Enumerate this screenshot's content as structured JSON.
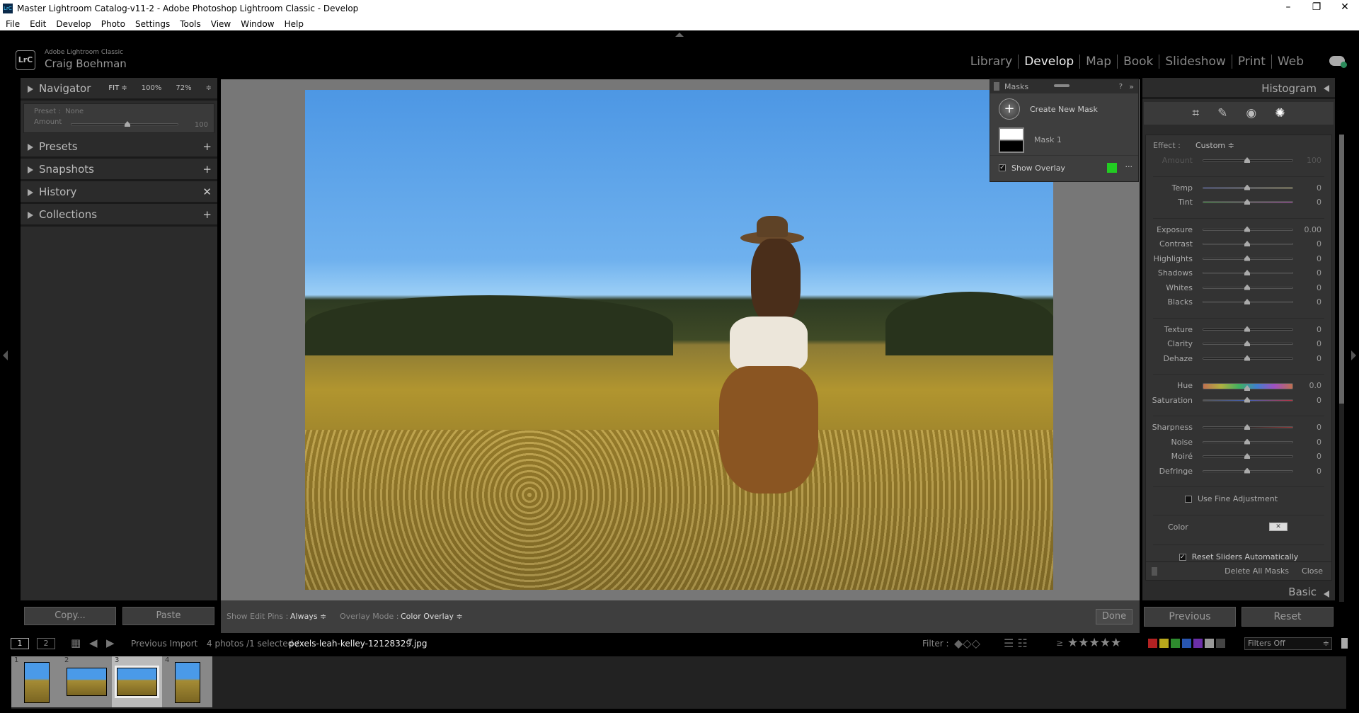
{
  "window": {
    "title": "Master Lightroom Catalog-v11-2 - Adobe Photoshop Lightroom Classic - Develop",
    "logo": "LrC",
    "min": "–",
    "max": "❐",
    "close": "✕"
  },
  "menu": [
    "File",
    "Edit",
    "Develop",
    "Photo",
    "Settings",
    "Tools",
    "View",
    "Window",
    "Help"
  ],
  "identity": {
    "product": "Adobe Lightroom Classic",
    "user": "Craig Boehman",
    "logo": "LrC"
  },
  "modules": [
    {
      "label": "Library",
      "active": false
    },
    {
      "label": "Develop",
      "active": true
    },
    {
      "label": "Map",
      "active": false
    },
    {
      "label": "Book",
      "active": false
    },
    {
      "label": "Slideshow",
      "active": false
    },
    {
      "label": "Print",
      "active": false
    },
    {
      "label": "Web",
      "active": false
    }
  ],
  "left": {
    "navigator": {
      "label": "Navigator",
      "fit": "FIT ≑",
      "z1": "100%",
      "z2": "72%",
      "stepper": "≑"
    },
    "preset": {
      "preset_label": "Preset :",
      "preset_value": "None",
      "amount_label": "Amount",
      "amount_value": "100",
      "amount_fraction": 0.5
    },
    "panels": [
      {
        "label": "Presets",
        "icon": "+"
      },
      {
        "label": "Snapshots",
        "icon": "+"
      },
      {
        "label": "History",
        "icon": "✕"
      },
      {
        "label": "Collections",
        "icon": "+"
      }
    ],
    "copy": "Copy...",
    "paste": "Paste"
  },
  "toolbar": {
    "pins_label": "Show Edit Pins :",
    "pins_value": "Always ≑",
    "overlay_label": "Overlay Mode :",
    "overlay_value": "Color Overlay ≑",
    "done": "Done"
  },
  "masks": {
    "title": "Masks",
    "help": "?",
    "collapse": "»",
    "create": "Create New Mask",
    "mask1": "Mask 1",
    "show_overlay": "Show Overlay",
    "overlay_checked": true,
    "overlay_color": "#22cc22",
    "more": "···"
  },
  "right": {
    "histogram": "Histogram",
    "effect_label": "Effect :",
    "effect_value": "Custom ≑",
    "groups": [
      [
        {
          "label": "Amount",
          "value": "100",
          "dim": true
        }
      ],
      [
        {
          "label": "Temp",
          "value": "0",
          "track": "temp"
        },
        {
          "label": "Tint",
          "value": "0",
          "track": "tint"
        }
      ],
      [
        {
          "label": "Exposure",
          "value": "0.00"
        },
        {
          "label": "Contrast",
          "value": "0"
        },
        {
          "label": "Highlights",
          "value": "0"
        },
        {
          "label": "Shadows",
          "value": "0"
        },
        {
          "label": "Whites",
          "value": "0"
        },
        {
          "label": "Blacks",
          "value": "0"
        }
      ],
      [
        {
          "label": "Texture",
          "value": "0"
        },
        {
          "label": "Clarity",
          "value": "0"
        },
        {
          "label": "Dehaze",
          "value": "0"
        }
      ],
      [
        {
          "label": "Hue",
          "value": "0.0",
          "track": "hue"
        }
      ],
      [
        {
          "label": "Saturation",
          "value": "0",
          "track": "sat"
        }
      ],
      [
        {
          "label": "Sharpness",
          "value": "0",
          "track": "sharp"
        },
        {
          "label": "Noise",
          "value": "0"
        },
        {
          "label": "Moiré",
          "value": "0"
        },
        {
          "label": "Defringe",
          "value": "0"
        }
      ]
    ],
    "fine_adjust": "Use Fine Adjustment",
    "color_label": "Color",
    "reset_auto": "Reset Sliders Automatically",
    "delete_all": "Delete All Masks",
    "close": "Close",
    "basic": "Basic",
    "previous": "Previous",
    "reset": "Reset"
  },
  "filmstrip": {
    "view1": "1",
    "view2": "2",
    "source": "Previous Import",
    "count": "4 photos /1 selected /",
    "filename": "pexels-leah-kelley-12128329.jpg",
    "filter_label": "Filter :",
    "filters_off": "Filters Off",
    "stars": "★★★★★",
    "gte": "≥",
    "labels": [
      "#b22222",
      "#b8a81c",
      "#2e8b2e",
      "#2855b0",
      "#6b2fa8",
      "#999999",
      "#444444"
    ],
    "thumbs": [
      {
        "n": "1",
        "selected": false
      },
      {
        "n": "2",
        "selected": false
      },
      {
        "n": "3",
        "selected": true
      },
      {
        "n": "4",
        "selected": false
      }
    ]
  }
}
